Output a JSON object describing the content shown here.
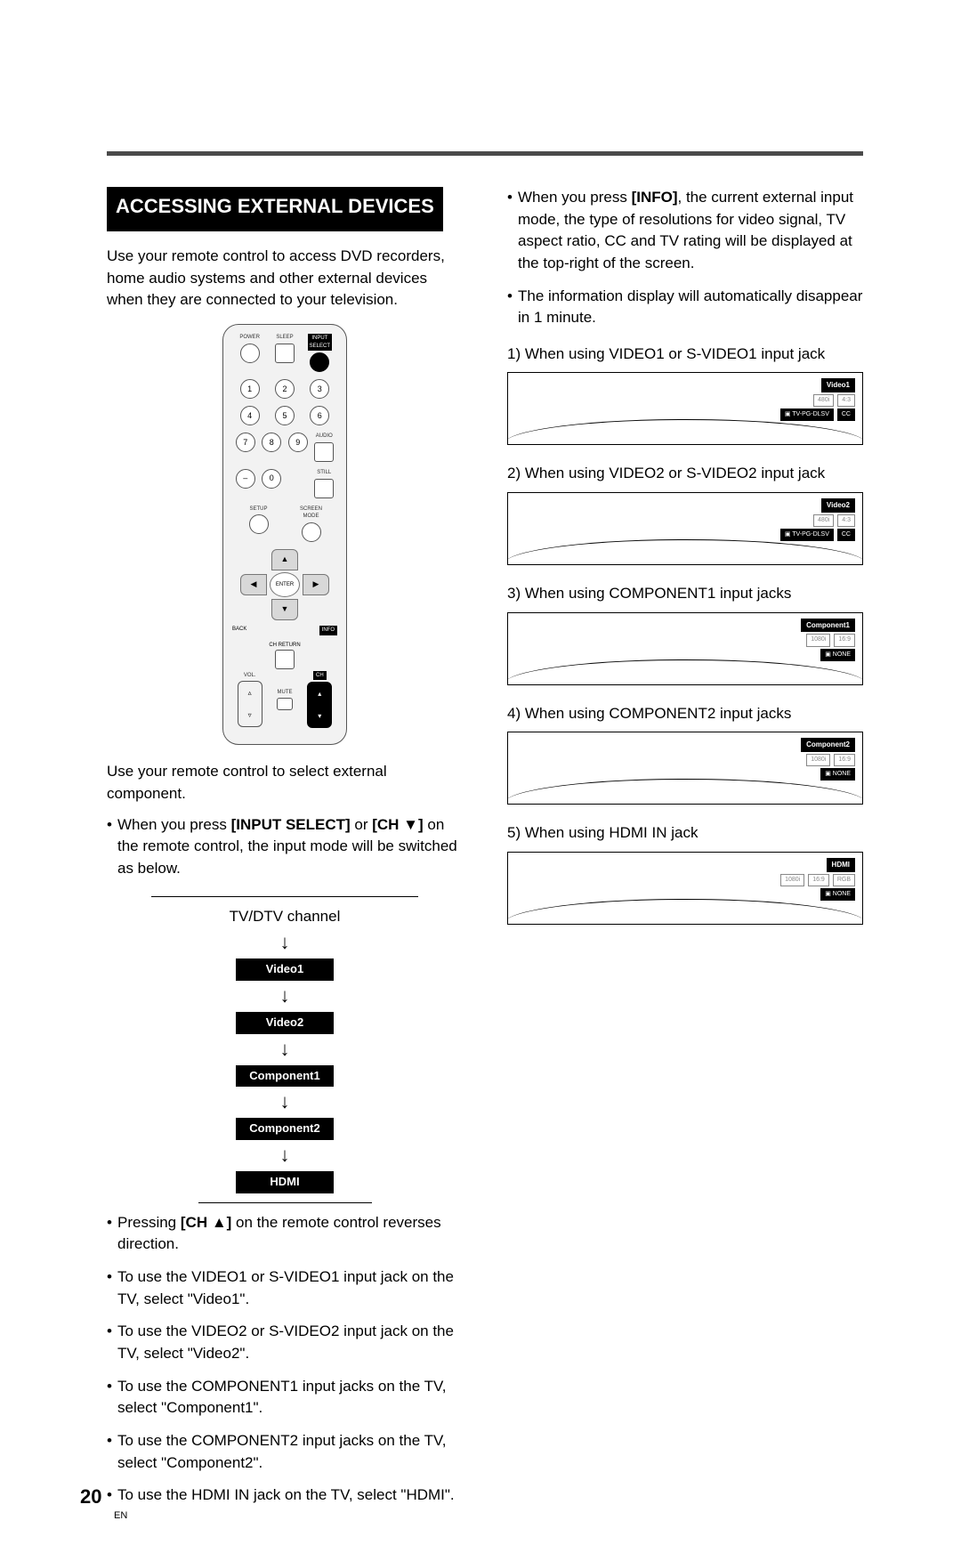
{
  "title": "ACCESSING EXTERNAL DEVICES",
  "page_number": "20",
  "lang": "EN",
  "intro": "Use your remote control to access DVD recorders, home audio systems and other external devices when they are connected to your television.",
  "remote_labels": {
    "power": "POWER",
    "sleep": "SLEEP",
    "input": "INPUT\nSELECT",
    "audio": "AUDIO",
    "still": "STILL",
    "setup": "SETUP",
    "screen": "SCREEN\nMODE",
    "back": "BACK",
    "info": "INFO",
    "chret": "CH RETURN",
    "enter": "ENTER",
    "vol": "VOL.",
    "mute": "MUTE",
    "ch": "CH"
  },
  "keys": {
    "k1": "1",
    "k2": "2",
    "k3": "3",
    "k4": "4",
    "k5": "5",
    "k6": "6",
    "k7": "7",
    "k8": "8",
    "k9": "9",
    "k0": "0",
    "dash": "–"
  },
  "p_select": "Use your remote control to select external component.",
  "bul1_pre": "When you press ",
  "bul1_b1": "[INPUT SELECT]",
  "bul1_mid": " or ",
  "bul1_b2": "[CH ▼]",
  "bul1_post": " on the remote control, the input mode will be switched as below.",
  "flow": {
    "top": "TV/DTV channel",
    "v1": "Video1",
    "v2": "Video2",
    "c1": "Component1",
    "c2": "Component2",
    "h": "HDMI"
  },
  "left_list": {
    "i1_pre": "Pressing ",
    "i1_b": "[CH ▲]",
    "i1_post": " on the remote control reverses direction.",
    "i2": "To use the VIDEO1 or S-VIDEO1 input jack on the TV, select \"Video1\".",
    "i3": "To use the VIDEO2 or S-VIDEO2 input jack on the TV, select \"Video2\".",
    "i4": "To use the COMPONENT1 input jacks on the TV, select \"Component1\".",
    "i5": "To use the COMPONENT2 input jacks on the TV, select \"Component2\".",
    "i6": "To use the HDMI IN jack on the TV, select \"HDMI\"."
  },
  "right_top": {
    "i1_pre": "When you press ",
    "i1_b": "[INFO]",
    "i1_post": ", the current external input mode, the type of resolutions for video signal, TV aspect ratio, CC and TV rating will be displayed at the top-right of the screen.",
    "i2": "The information display will automatically disappear in 1 minute."
  },
  "examples": [
    {
      "cap": "1) When using VIDEO1 or S-VIDEO1 input jack",
      "label": "Video1",
      "row": [
        "480i",
        "4:3"
      ],
      "bot": [
        "▣ TV-PG-DLSV",
        "CC"
      ]
    },
    {
      "cap": "2) When using VIDEO2 or S-VIDEO2 input jack",
      "label": "Video2",
      "row": [
        "480i",
        "4:3"
      ],
      "bot": [
        "▣ TV-PG-DLSV",
        "CC"
      ]
    },
    {
      "cap": "3) When using COMPONENT1 input jacks",
      "label": "Component1",
      "row": [
        "1080i",
        "16:9"
      ],
      "bot": [
        "▣ NONE"
      ]
    },
    {
      "cap": "4) When using COMPONENT2 input jacks",
      "label": "Component2",
      "row": [
        "1080i",
        "16:9"
      ],
      "bot": [
        "▣ NONE"
      ]
    },
    {
      "cap": "5) When using HDMI IN jack",
      "label": "HDMI",
      "row": [
        "1080i",
        "16:9",
        "RGB"
      ],
      "bot": [
        "▣ NONE"
      ]
    }
  ]
}
